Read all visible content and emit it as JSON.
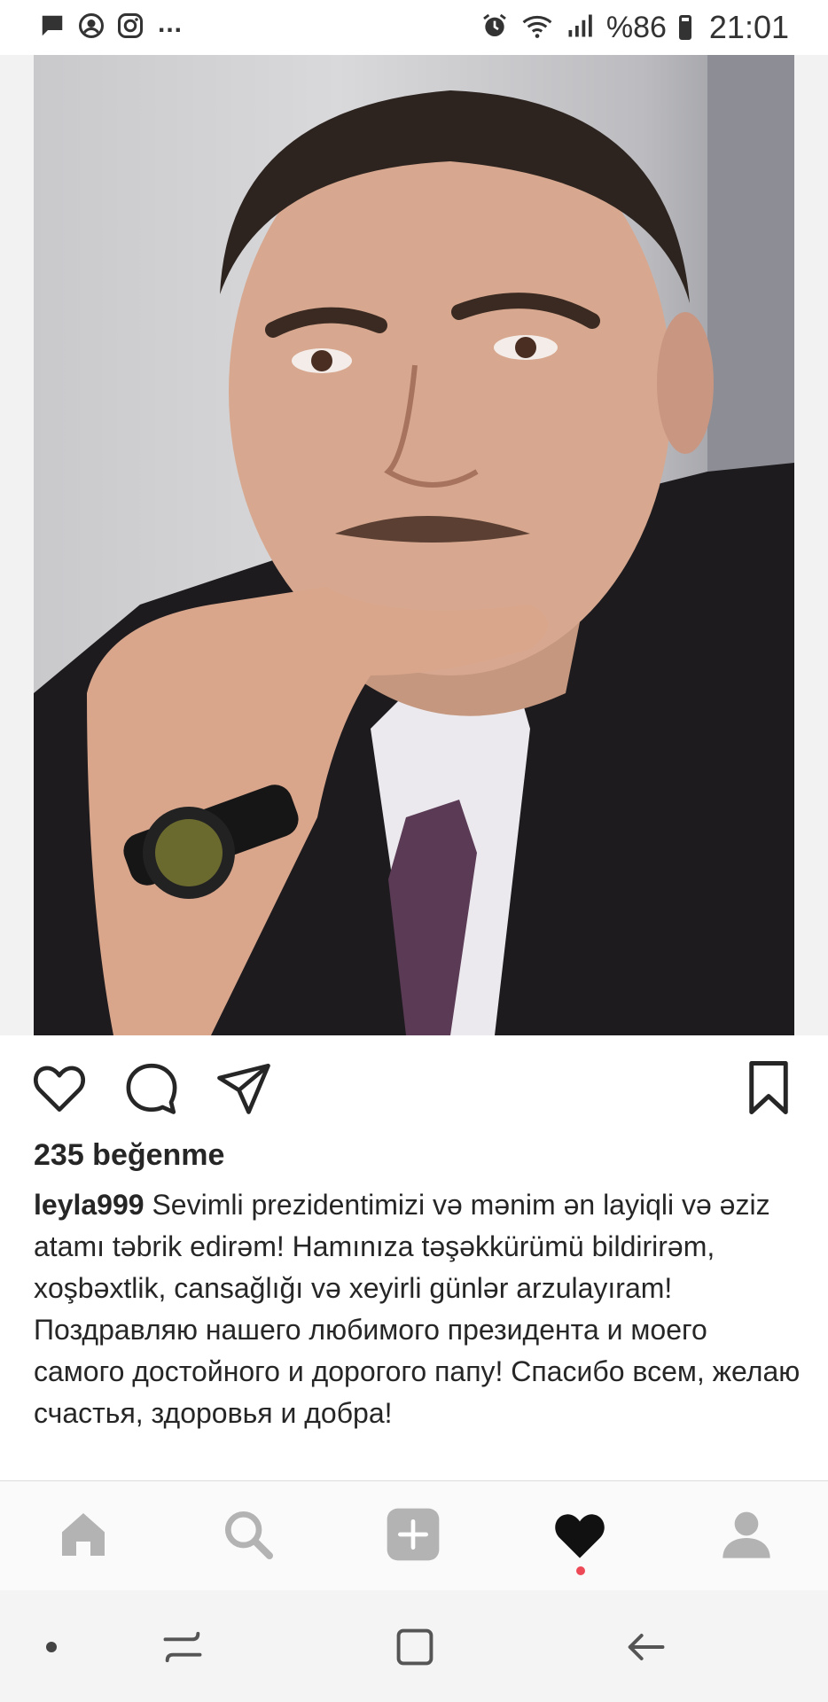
{
  "status_bar": {
    "left_icons": [
      "message-icon",
      "account-circle-icon",
      "instagram-icon"
    ],
    "more": "...",
    "right_icons": [
      "alarm-icon",
      "wifi-icon",
      "signal-icon",
      "battery-icon"
    ],
    "battery": "%86",
    "time": "21:01"
  },
  "post": {
    "image": "portrait-photo",
    "actions": [
      "heart-icon",
      "comment-icon",
      "share-icon",
      "bookmark-icon"
    ],
    "likes": "235 beğenme",
    "username": "leyla999",
    "caption_az": "Sevimli prezidentimizi və mənim ən layiqli və əziz atamı təbrik edirəm! Hamınıza təşəkkürümü bildirirəm, xoşbəxtlik, cansağlığı və xeyirli günlər arzulayıram!",
    "caption_ru": "Поздравляю нашего любимого президента и моего самого достойного и дорогого папу! Спасибо всем, желаю счастья, здоровья и добра!"
  },
  "ig_nav": {
    "items": [
      "home-icon",
      "search-icon",
      "add-icon",
      "heart-filled-icon",
      "profile-icon"
    ],
    "active": "heart-filled-icon",
    "notification_color": "#ed4956"
  },
  "android_nav": {
    "items": [
      "dot-icon",
      "recents-icon",
      "home-square-icon",
      "back-icon"
    ]
  }
}
